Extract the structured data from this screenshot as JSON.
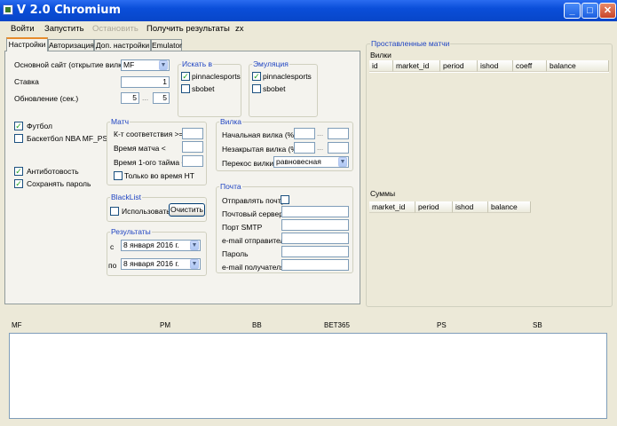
{
  "window": {
    "title": "V 2.0 Chromium",
    "minimize": "_",
    "maximize": "□",
    "close": "✕"
  },
  "menu": {
    "login": "Войти",
    "start": "Запустить",
    "stop": "Остановить",
    "results": "Получить результаты",
    "zx": "zx"
  },
  "tabs": [
    "Настройки",
    "Авторизация",
    "Доп. настройки",
    "Emulator"
  ],
  "settings": {
    "main_site_label": "Основной сайт (открытие вилки)",
    "main_site_value": "MF",
    "stake_label": "Ставка",
    "stake_value": "1",
    "update_label": "Обновление (сек.)",
    "update_from": "5",
    "update_sep": "...",
    "update_to": "5",
    "football": "Футбол",
    "basketball": "Баскетбол NBA MF_PS",
    "antibot": "Антиботовость",
    "save_password": "Сохранять пароль"
  },
  "search_in": {
    "title": "Искать в",
    "pinnacle": "pinnaclesports",
    "sbobet": "sbobet"
  },
  "emulation": {
    "title": "Эмуляция",
    "pinnacle": "pinnaclesports",
    "sbobet": "sbobet"
  },
  "match": {
    "title": "Матч",
    "coef_label": "К-т соответствия >=",
    "time_label": "Время матча <",
    "first_half_label": "Время 1-ого тайма <",
    "ht_only": "Только во время HT"
  },
  "fork": {
    "title": "Вилка",
    "initial_label": "Начальная вилка (%)",
    "sep1": "...",
    "unclosed_label": "Незакрытая вилка (%)",
    "sep2": "...",
    "skew_label": "Перекос вилки",
    "skew_value": "равновесная"
  },
  "blacklist": {
    "title": "BlackList",
    "use": "Использовать",
    "clear": "Очистить"
  },
  "results": {
    "title": "Результаты",
    "from_label": "с",
    "from_value": "8   января   2016 г.",
    "to_label": "по",
    "to_value": "8   января   2016 г."
  },
  "mail": {
    "title": "Почта",
    "send_label": "Отправлять почту",
    "server_label": "Почтовый сервер",
    "port_label": "Порт SMTP",
    "sender_label": "e-mail отправителя",
    "password_label": "Пароль",
    "recipient_label": "e-mail получателя"
  },
  "placed": {
    "title": "Проставленные матчи",
    "forks_label": "Вилки",
    "forks_columns": [
      "id",
      "market_id",
      "period",
      "ishod",
      "coeff",
      "balance"
    ],
    "sums_label": "Суммы",
    "sums_columns": [
      "market_id",
      "period",
      "ishod",
      "balance"
    ]
  },
  "bookmakers": [
    "MF",
    "PM",
    "BB",
    "BET365",
    "PS",
    "SB"
  ],
  "icons": {
    "checkmark": "✓",
    "dropdown": "▼"
  }
}
